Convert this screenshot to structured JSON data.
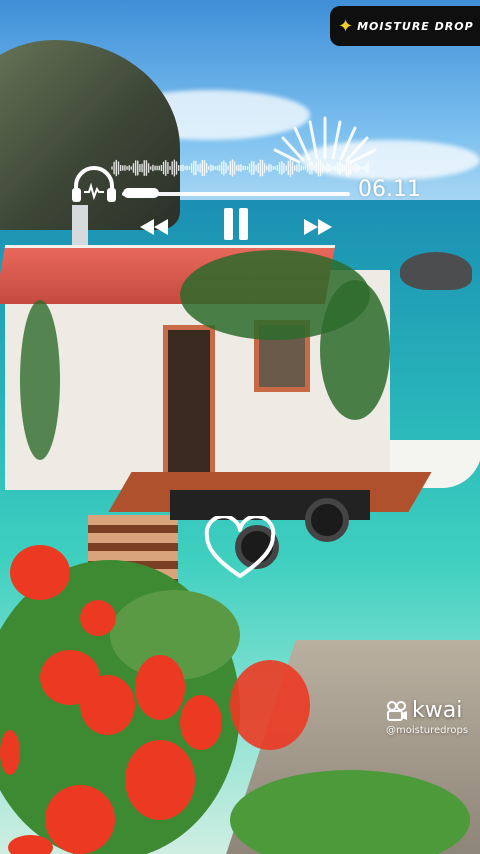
{
  "badge": {
    "text": "MOISTURE DROP",
    "icon": "sparkle-star-icon",
    "star_color": "#f4d12c"
  },
  "player": {
    "time": "06.11",
    "progress": 0.05,
    "controls": [
      "rewind-icon",
      "pause-icon",
      "fast-forward-icon"
    ]
  },
  "overlay": {
    "heart_icon": "heart-outline-icon"
  },
  "watermark": {
    "brand": "kwai",
    "handle": "@moisturedrops"
  },
  "colors": {
    "sea": "#27b3b9",
    "roof": "#e9685c",
    "flowers": "#ec3a22",
    "overlay": "#ffffff"
  }
}
